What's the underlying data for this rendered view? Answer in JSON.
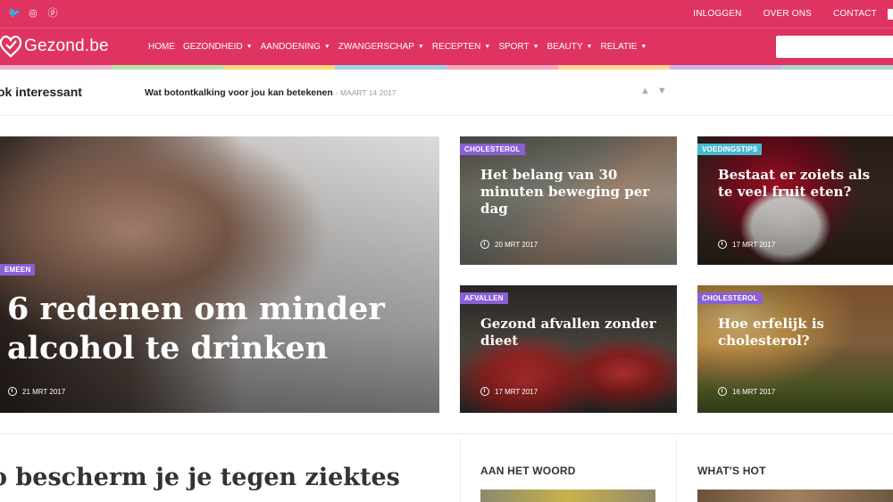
{
  "topbar": {
    "social": [
      {
        "icon": "twitter-icon",
        "glyph": "🐦"
      },
      {
        "icon": "instagram-icon",
        "glyph": "◎"
      },
      {
        "icon": "pinterest-icon",
        "glyph": "ⓟ"
      }
    ],
    "links": [
      "INLOGGEN",
      "OVER ONS",
      "CONTACT"
    ]
  },
  "nav": {
    "logo_text": "Gezond.be",
    "items": [
      {
        "label": "HOME",
        "dropdown": false
      },
      {
        "label": "GEZONDHEID",
        "dropdown": true
      },
      {
        "label": "AANDOENING",
        "dropdown": true
      },
      {
        "label": "ZWANGERSCHAP",
        "dropdown": true
      },
      {
        "label": "RECEPTEN",
        "dropdown": true
      },
      {
        "label": "SPORT",
        "dropdown": true
      },
      {
        "label": "BEAUTY",
        "dropdown": true
      },
      {
        "label": "RELATIE",
        "dropdown": true
      }
    ],
    "search_placeholder": ""
  },
  "colors": {
    "brand": "#df3462",
    "category_purple": "#8b5fd6",
    "category_teal": "#49b8cf",
    "rainbow": [
      "#f0b4c8",
      "#b6e3a8",
      "#f9d97e",
      "#9fd2ea",
      "#f7a9b8",
      "#ffd591",
      "#c8b6ea",
      "#a9d8d0"
    ]
  },
  "ticker": {
    "label": "ok interessant",
    "headline": "Wat botontkalking voor jou kan betekenen",
    "date": "- MAART 14 2017"
  },
  "featured": {
    "badge": "EMEEN",
    "title": "6 redenen om minder alcohol te drinken",
    "date": "21 MRT 2017"
  },
  "cards": [
    {
      "badge": "CHOLESTEROL",
      "title": "Het belang van 30 minuten beweging per dag",
      "date": "20 MRT 2017"
    },
    {
      "badge": "VOEDINGSTIPS",
      "title": "Bestaat er zoiets als te veel fruit eten?",
      "date": "17 MRT 2017"
    },
    {
      "badge": "AFVALLEN",
      "title": "Gezond afvallen zonder dieet",
      "date": "17 MRT 2017"
    },
    {
      "badge": "CHOLESTEROL",
      "title": "Hoe erfelijk is cholesterol?",
      "date": "16 MRT 2017"
    }
  ],
  "bottom": {
    "section_title": "o bescherm je je tegen ziektes",
    "col1_title": "AAN HET WOORD",
    "col2_title": "WHAT'S HOT"
  }
}
